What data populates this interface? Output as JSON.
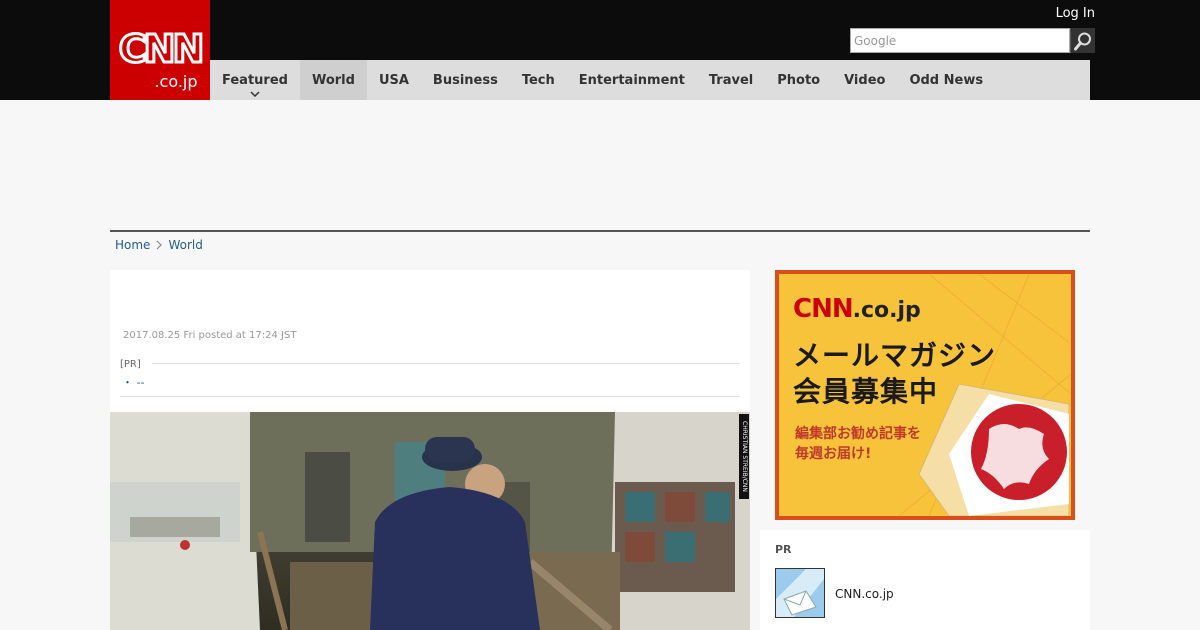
{
  "header": {
    "logo_top": "CNN",
    "logo_bottom": ".co.jp",
    "login_label": "Log In",
    "search_placeholder": "Google"
  },
  "nav": {
    "items": [
      "Featured",
      "World",
      "USA",
      "Business",
      "Tech",
      "Entertainment",
      "Travel",
      "Photo",
      "Video",
      "Odd News"
    ],
    "active": "World"
  },
  "breadcrumb": {
    "home": "Home",
    "current": "World"
  },
  "article": {
    "date": "2017.08.25 Fri posted at 17:24 JST",
    "pr_label": "[PR]",
    "pr_item": "・ --",
    "photo_credit": "CHRISTIAN STREIB/CNN"
  },
  "sidebar": {
    "banner": {
      "logo_cnn": "CNN",
      "logo_cojp": ".co.jp",
      "title_line1": "メールマガジン",
      "title_line2": "会員募集中",
      "sub_line1": "編集部お勧め記事を",
      "sub_line2": "毎週お届け!"
    },
    "pr": {
      "label": "PR",
      "item_text": "CNN.co.jp"
    }
  },
  "colors": {
    "brand_red": "#cc0000",
    "header_black": "#0c0c0c",
    "nav_gray": "#dddddd",
    "link_blue": "#245c8a",
    "banner_yellow": "#f7c33a"
  }
}
